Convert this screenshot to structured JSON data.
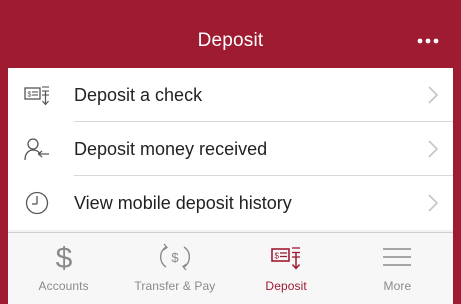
{
  "colors": {
    "brand": "#9e1b32",
    "tab_inactive": "#8a8a8a",
    "text": "#222222",
    "divider": "#d8d8d8"
  },
  "header": {
    "title": "Deposit",
    "more_icon": "more-dots-icon"
  },
  "menu": {
    "items": [
      {
        "label": "Deposit a check",
        "icon": "check-deposit-icon"
      },
      {
        "label": "Deposit money received",
        "icon": "person-receive-icon"
      },
      {
        "label": "View mobile deposit history",
        "icon": "clock-icon"
      }
    ]
  },
  "tabbar": {
    "active": "Deposit",
    "tabs": [
      {
        "label": "Accounts",
        "icon": "dollar-icon"
      },
      {
        "label": "Transfer & Pay",
        "icon": "transfer-dollar-icon"
      },
      {
        "label": "Deposit",
        "icon": "check-deposit-icon"
      },
      {
        "label": "More",
        "icon": "hamburger-icon"
      }
    ]
  }
}
